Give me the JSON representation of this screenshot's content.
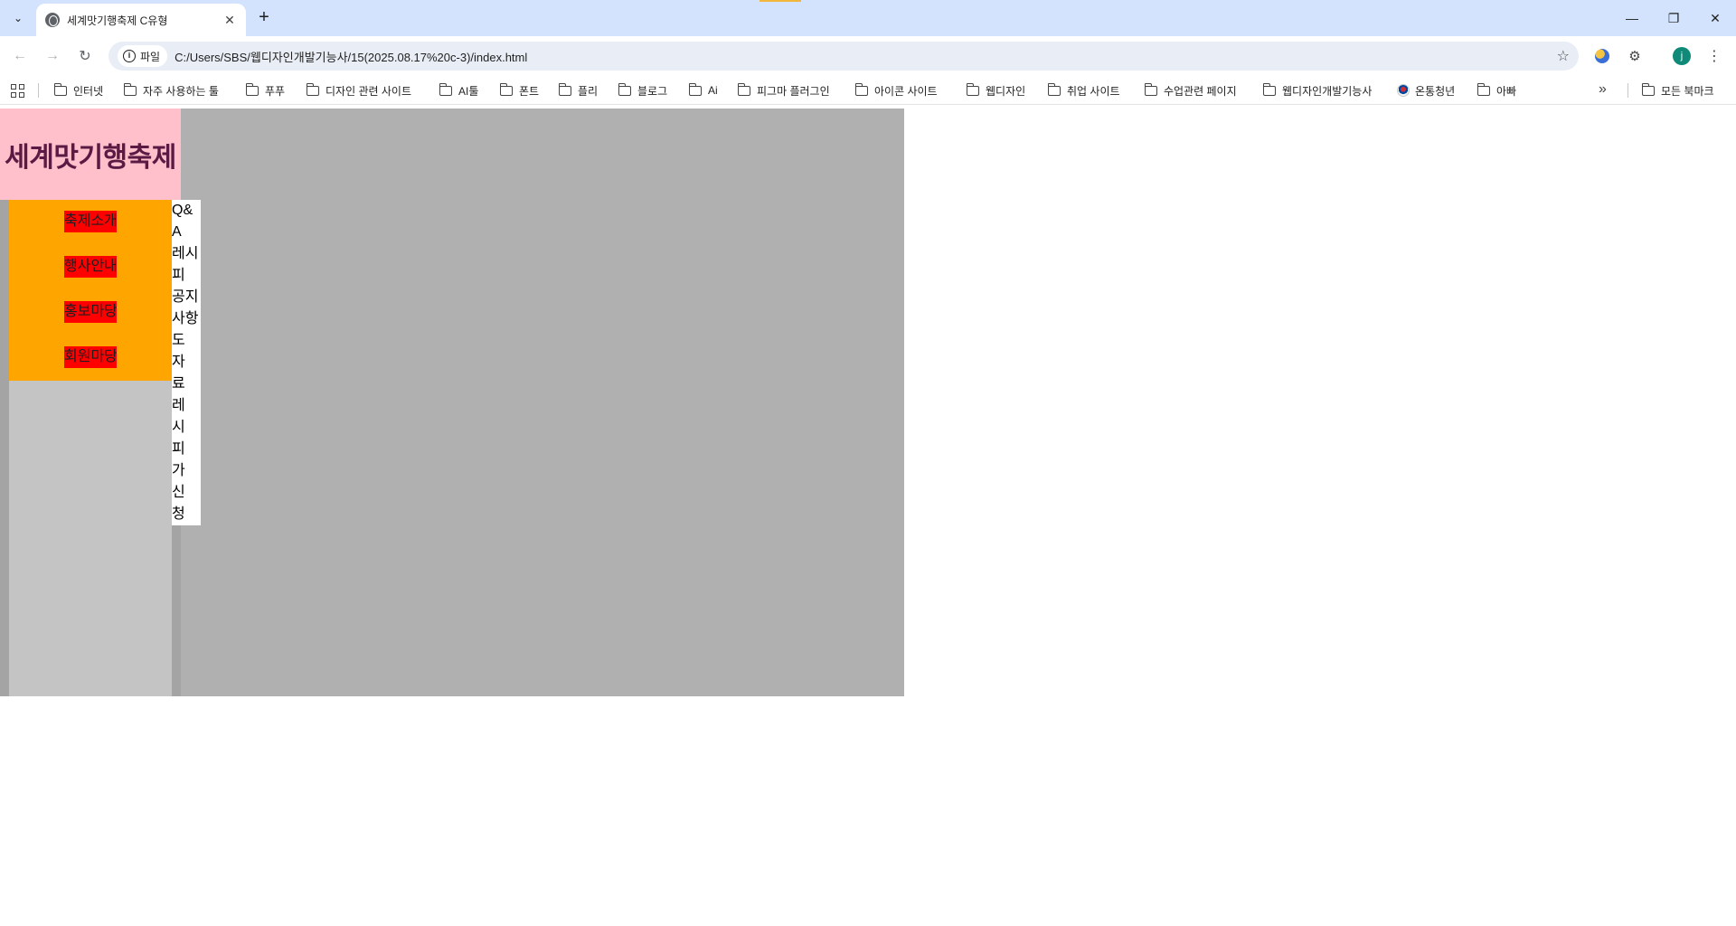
{
  "browser": {
    "tab": {
      "title": "세계맛기행축제 C유형"
    },
    "address": {
      "chip_label": "파일",
      "url": "C:/Users/SBS/웹디자인개발기능사/15(2025.08.17%20c-3)/index.html"
    },
    "profile_initial": "j",
    "bookmarks": [
      "인터넷",
      "자주 사용하는 툴",
      "푸푸",
      "디자인 관련 사이트",
      "AI툴",
      "폰트",
      "플리",
      "블로그",
      "Ai",
      "피그마 플러그인",
      "아이콘 사이트",
      "웹디자인",
      "취업 사이트",
      "수업관련 페이지",
      "웹디자인개발기능사",
      "온통청년",
      "아빠"
    ],
    "all_bookmarks": "모든 북마크"
  },
  "page": {
    "logo": "세계맛기행축제",
    "menu": [
      "축제소개",
      "행사안내",
      "홍보마당",
      "회원마당"
    ],
    "submenu_text": "Q&A\n레시\n피\n공지\n사항\n도\n자\n료\n레\n시\n피\n가\n신\n청"
  },
  "colors": {
    "logo_bg": "#ffc0cb",
    "menu_bg": "#ffa500",
    "menu_item_bg": "#ff0000",
    "wrap_bg": "#b0b0b0",
    "side_bg": "#c4c4c4"
  }
}
